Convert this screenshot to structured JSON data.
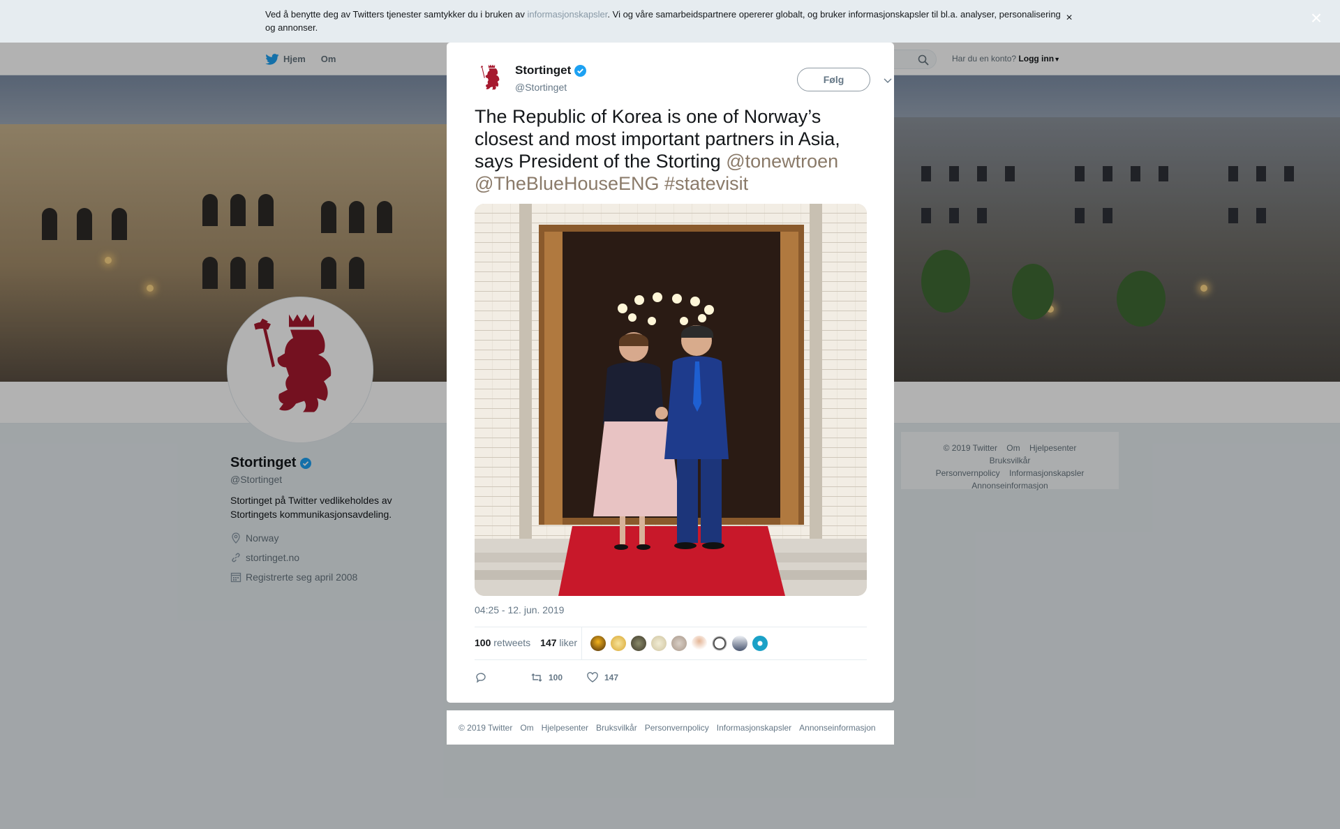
{
  "cookie_bar": {
    "text_before": "Ved å benytte deg av Twitters tjenester samtykker du i bruken av ",
    "link": "informasjonskapsler",
    "text_after": ". Vi og våre samarbeidspartnere opererer globalt, og bruker informasjonskapsler til bl.a. analyser, personalisering og annonser.",
    "close": "×"
  },
  "overlay_close": "×",
  "topnav": {
    "home": "Hjem",
    "about": "Om",
    "account_prompt": "Har du en konto?",
    "login": "Logg inn"
  },
  "profile": {
    "name": "Stortinget",
    "handle": "@Stortinget",
    "bio": "Stortinget på Twitter vedlikeholdes av Stortingets kommunikasjonsavdeling.",
    "location": "Norway",
    "website": "stortinget.no",
    "joined": "Registrerte seg april 2008"
  },
  "side_footer": {
    "line1": [
      "© 2019 Twitter",
      "Om",
      "Hjelpesenter",
      "Bruksvilkår"
    ],
    "line2": [
      "Personvernpolicy",
      "Informasjonskapsler"
    ],
    "line3": [
      "Annonseinformasjon"
    ]
  },
  "tweet": {
    "name": "Stortinget",
    "handle": "@Stortinget",
    "follow": "Følg",
    "text": "The Republic of Korea is one of Norway’s closest and most important partners in Asia, says President of the Storting ",
    "mention1": "@tonewtroen",
    "mention2": "@TheBlueHouseENG",
    "hashtag": "#statevisit",
    "timestamp": "04:25 - 12. jun. 2019",
    "retweets_count": "100",
    "retweets_label": "retweets",
    "likes_count": "147",
    "likes_label": "liker",
    "action_retweets": "100",
    "action_likes": "147"
  },
  "modal_footer": [
    "© 2019 Twitter",
    "Om",
    "Hjelpesenter",
    "Bruksvilkår",
    "Personvernpolicy",
    "Informasjonskapsler",
    "Annonseinformasjon"
  ],
  "colors": {
    "brand_red": "#a6192e",
    "verified_blue": "#1da1f2",
    "mention": "#8a7a69",
    "muted": "#657786"
  },
  "icons": [
    "twitter-bird-icon",
    "search-icon",
    "verified-icon",
    "location-icon",
    "link-icon",
    "calendar-icon",
    "chevron-down-icon",
    "reply-icon",
    "retweet-icon",
    "like-icon",
    "close-icon"
  ]
}
